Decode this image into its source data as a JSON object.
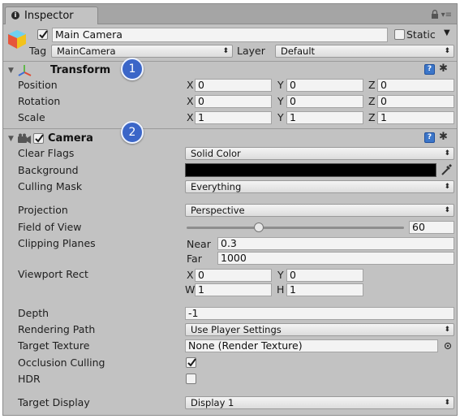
{
  "window": {
    "tab_title": "Inspector"
  },
  "header": {
    "active_checked": true,
    "object_name": "Main Camera",
    "static_label": "Static",
    "static_checked": false,
    "tag_label": "Tag",
    "tag_value": "MainCamera",
    "layer_label": "Layer",
    "layer_value": "Default"
  },
  "transform": {
    "title": "Transform",
    "badge": "1",
    "rows": [
      {
        "label": "Position",
        "x": "0",
        "y": "0",
        "z": "0"
      },
      {
        "label": "Rotation",
        "x": "0",
        "y": "0",
        "z": "0"
      },
      {
        "label": "Scale",
        "x": "1",
        "y": "1",
        "z": "1"
      }
    ],
    "axis": {
      "x": "X",
      "y": "Y",
      "z": "Z"
    }
  },
  "camera": {
    "title": "Camera",
    "badge": "2",
    "enabled": true,
    "clear_flags_label": "Clear Flags",
    "clear_flags_value": "Solid Color",
    "background_label": "Background",
    "background_color": "#000000",
    "culling_mask_label": "Culling Mask",
    "culling_mask_value": "Everything",
    "projection_label": "Projection",
    "projection_value": "Perspective",
    "fov_label": "Field of View",
    "fov_value": "60",
    "fov_min": 1,
    "fov_max": 179,
    "clipping_label": "Clipping Planes",
    "near_label": "Near",
    "near_value": "0.3",
    "far_label": "Far",
    "far_value": "1000",
    "viewport_label": "Viewport Rect",
    "viewport": {
      "x_label": "X",
      "x": "0",
      "y_label": "Y",
      "y": "0",
      "w_label": "W",
      "w": "1",
      "h_label": "H",
      "h": "1"
    },
    "depth_label": "Depth",
    "depth_value": "-1",
    "rendering_path_label": "Rendering Path",
    "rendering_path_value": "Use Player Settings",
    "target_texture_label": "Target Texture",
    "target_texture_value": "None (Render Texture)",
    "occlusion_label": "Occlusion Culling",
    "occlusion_checked": true,
    "hdr_label": "HDR",
    "hdr_checked": false,
    "target_display_label": "Target Display",
    "target_display_value": "Display 1"
  },
  "colors": {
    "panel_bg": "#c2c2c2",
    "badge_blue": "#3b66c8",
    "help_blue": "#3c76c9"
  }
}
